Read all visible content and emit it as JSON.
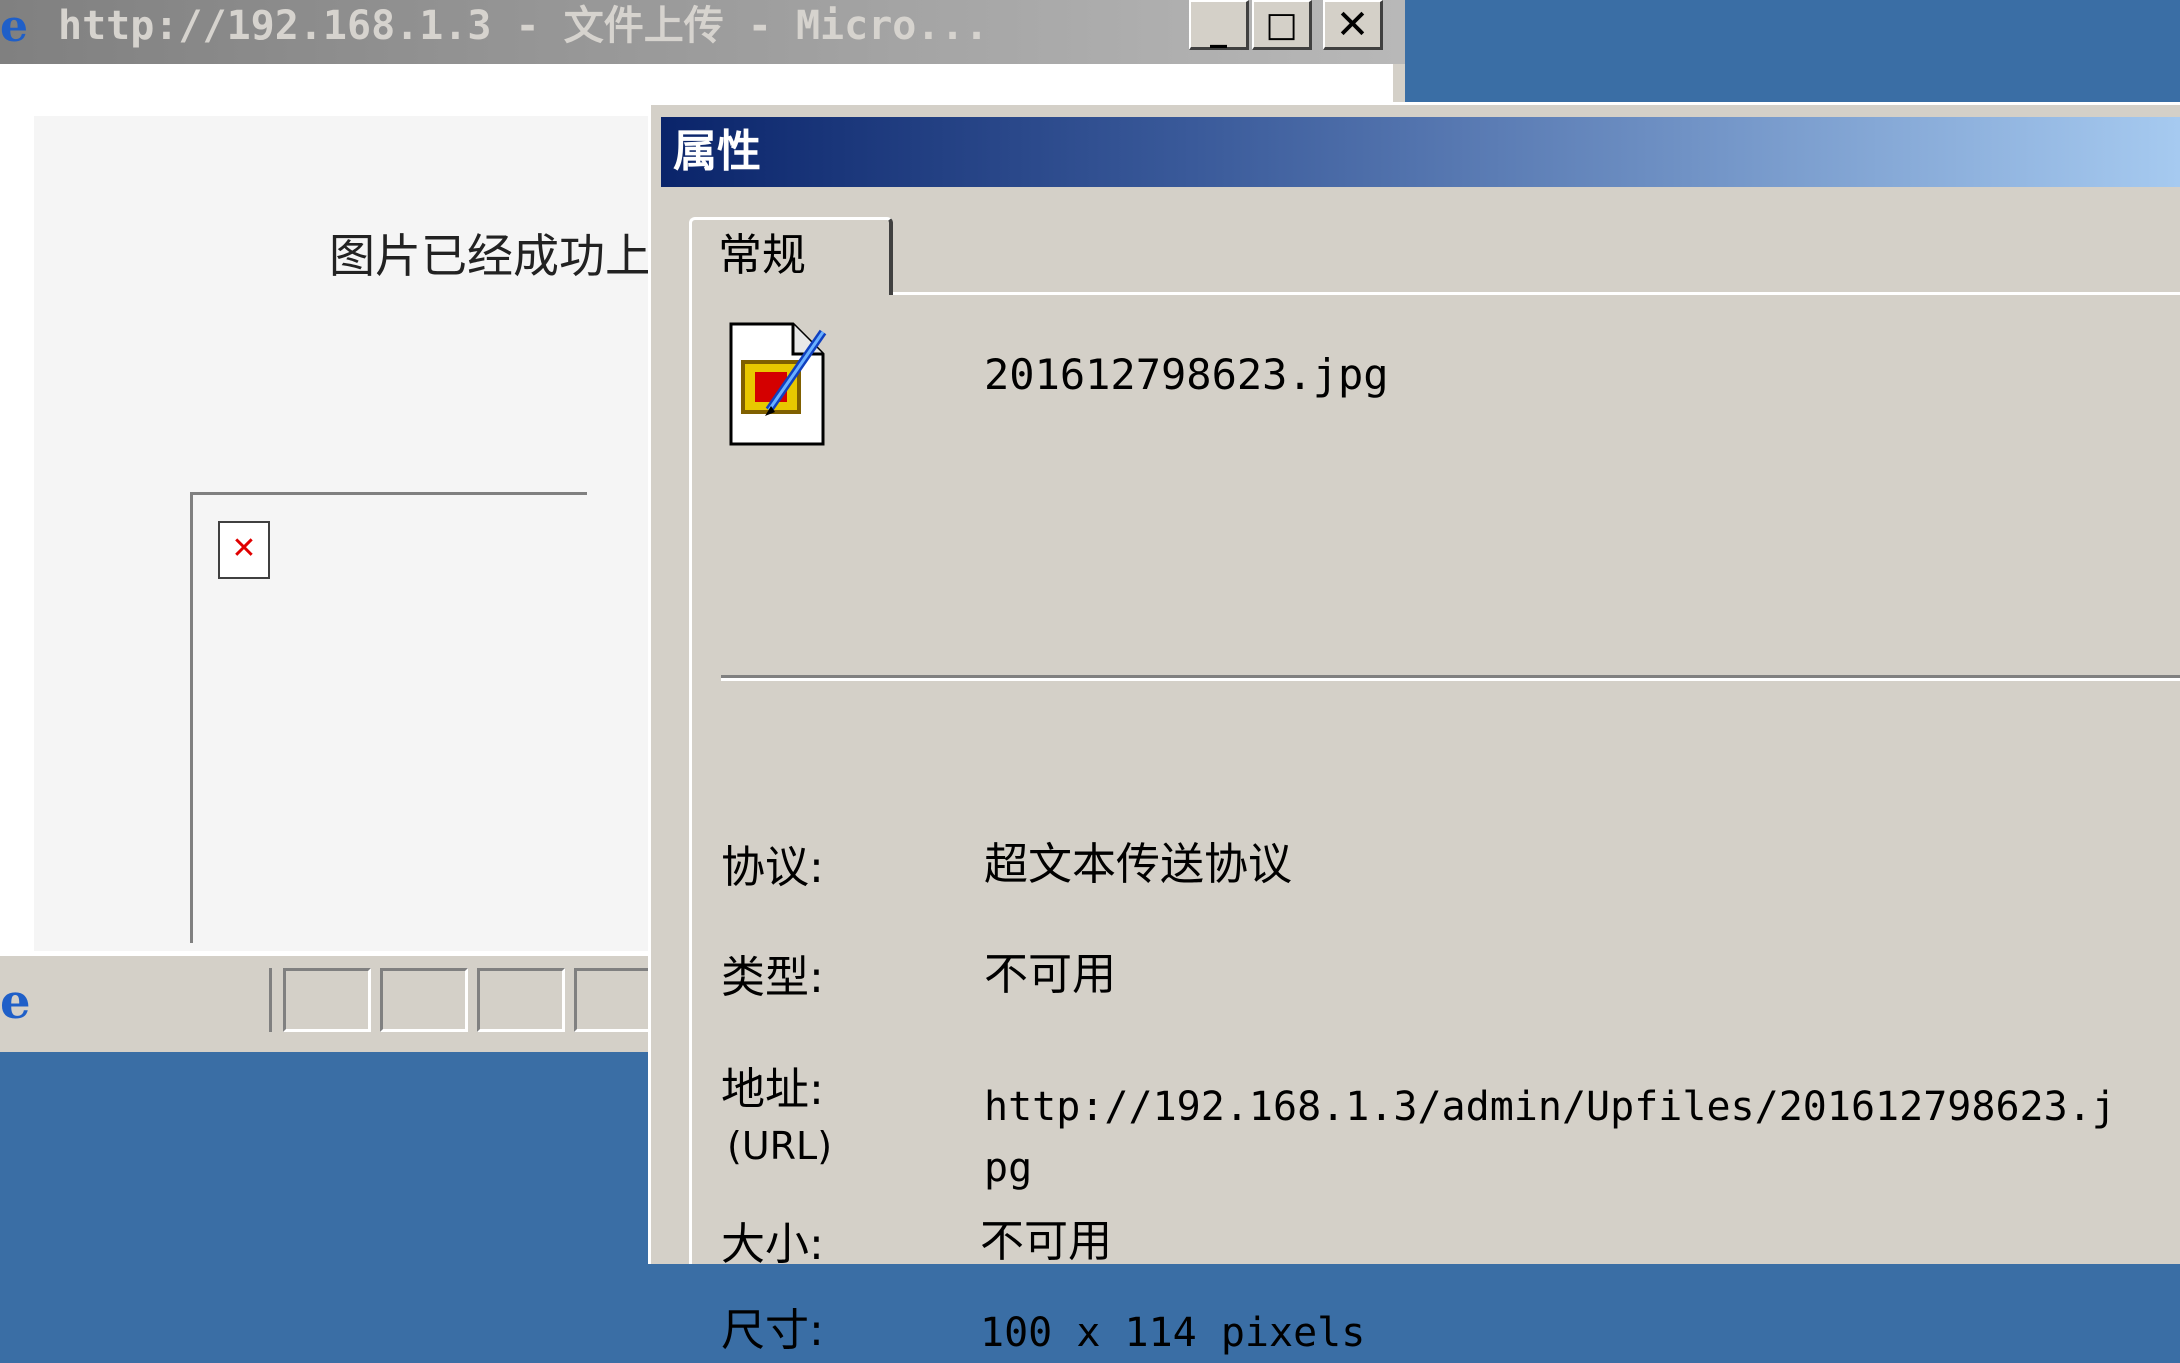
{
  "ie_window": {
    "title": "http://192.168.1.3 - 文件上传 - Micro...",
    "minimize_glyph": "_",
    "maximize_glyph": "□",
    "close_glyph": "✕",
    "message": "图片已经成功上",
    "title_icon": "ie-logo-icon",
    "status_icon": "ie-page-icon"
  },
  "properties_dialog": {
    "title": "属性",
    "tabs": [
      {
        "label": "常规",
        "selected": true
      }
    ],
    "file_name": "201612798623.jpg",
    "fields": {
      "protocol": {
        "label": "协议:",
        "value": "超文本传送协议"
      },
      "type": {
        "label": "类型:",
        "value": "不可用"
      },
      "address": {
        "label_line1": "地址:",
        "label_line2": "(URL)",
        "value_line1": "http://192.168.1.3/admin/Upfiles/201612798623.j",
        "value_line2": "pg"
      },
      "size": {
        "label": "大小:",
        "value": "不可用"
      },
      "dimensions": {
        "label": "尺寸:",
        "value": "100 x 114 pixels"
      }
    }
  },
  "colors": {
    "desktop": "#3a6ea5",
    "inactive_title": "#808080",
    "active_title_start": "#0a246a",
    "active_title_end": "#a6caf0",
    "dialog_face": "#d4d0c8",
    "broken_image_x": "#e00000"
  }
}
